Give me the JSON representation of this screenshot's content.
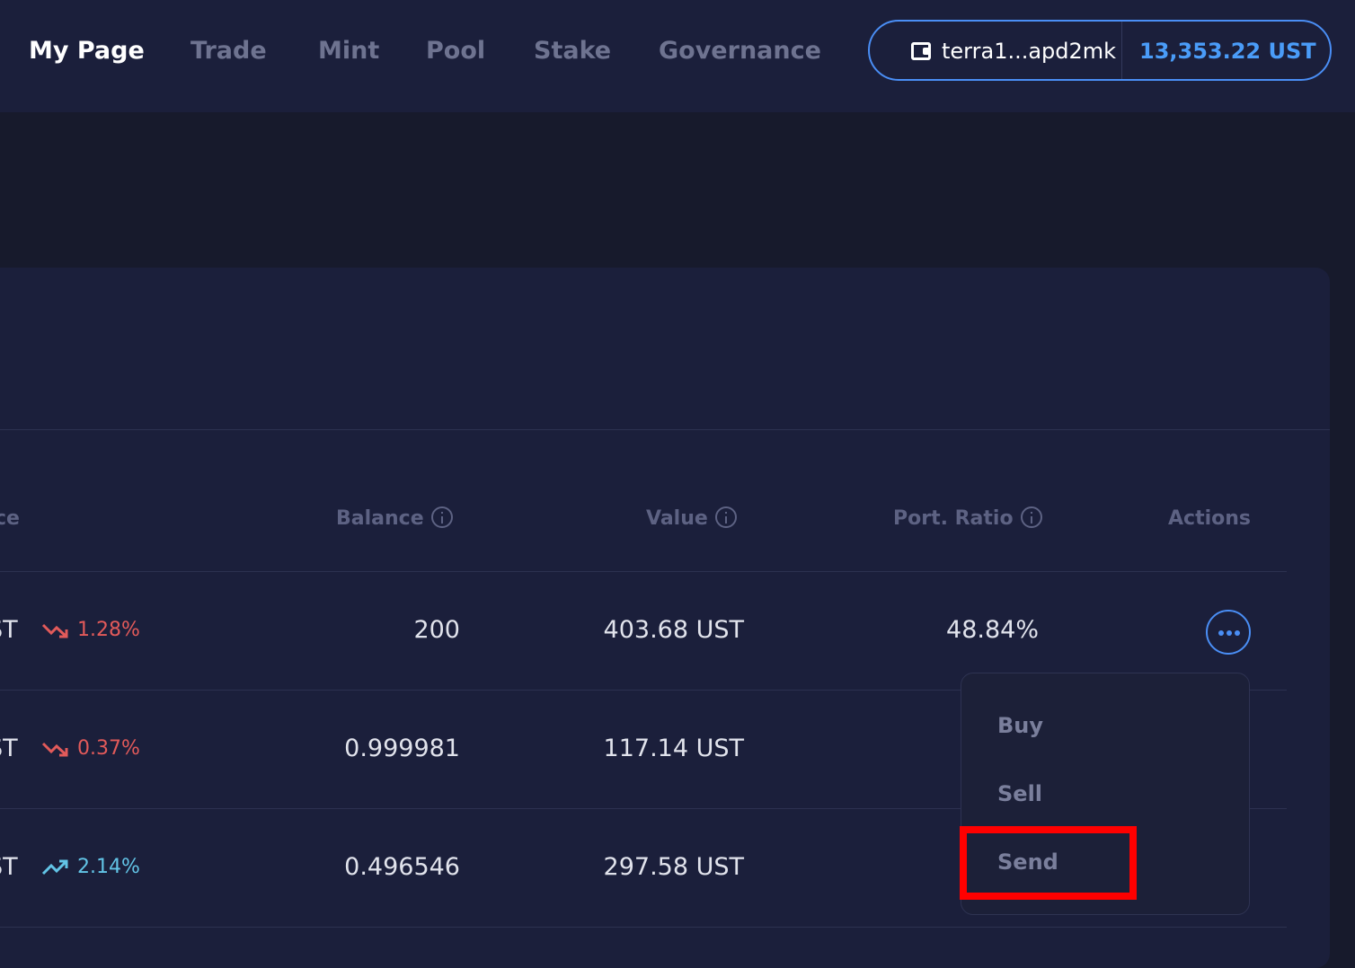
{
  "nav": {
    "items": [
      {
        "label": "My Page"
      },
      {
        "label": "Trade"
      },
      {
        "label": "Mint"
      },
      {
        "label": "Pool"
      },
      {
        "label": "Stake"
      },
      {
        "label": "Governance"
      }
    ],
    "active": "My Page"
  },
  "wallet": {
    "icon": "wallet-icon",
    "address": "terra1...apd2mk",
    "balance": "13,353.22 UST"
  },
  "table": {
    "columns": {
      "price_partial": "ce",
      "balance": "Balance",
      "value": "Value",
      "port_ratio": "Port. Ratio",
      "actions": "Actions"
    },
    "rows": [
      {
        "price_unit": "ST",
        "change": "1.28%",
        "change_dir": "down",
        "balance": "200",
        "value": "403.68 UST",
        "port_ratio": "48.84%"
      },
      {
        "price_unit": "ST",
        "change": "0.37%",
        "change_dir": "down",
        "balance": "0.999981",
        "value": "117.14 UST",
        "port_ratio": ""
      },
      {
        "price_unit": "ST",
        "change": "2.14%",
        "change_dir": "up",
        "balance": "0.496546",
        "value": "297.58 UST",
        "port_ratio": ""
      }
    ]
  },
  "actions_menu": {
    "items": [
      {
        "label": "Buy"
      },
      {
        "label": "Sell"
      },
      {
        "label": "Send"
      }
    ],
    "highlighted": "Send"
  },
  "colors": {
    "accent": "#4a8ef5",
    "down": "#e25a5a",
    "up": "#62c4e6",
    "highlight": "#ff0000"
  }
}
